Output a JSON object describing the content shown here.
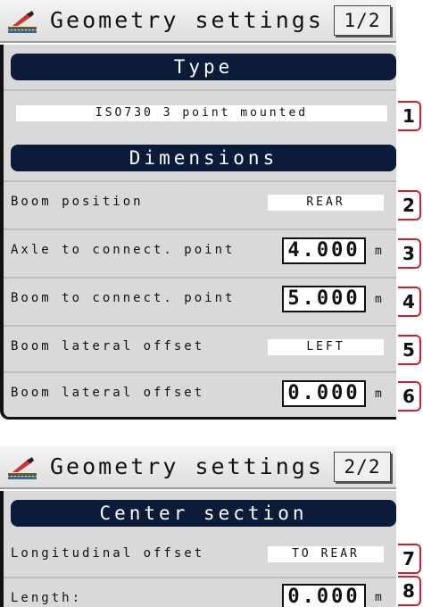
{
  "screen1": {
    "title": "Geometry settings",
    "page": "1/2",
    "type_header": "Type",
    "type_value": "ISO730 3 point mounted",
    "type_callout": "1",
    "dimensions_header": "Dimensions",
    "rows": [
      {
        "label": "Boom position",
        "value": "REAR",
        "unit": "",
        "callout": "2"
      },
      {
        "label": "Axle to connect. point",
        "value": "4.000",
        "unit": "m",
        "callout": "3"
      },
      {
        "label": "Boom to connect. point",
        "value": "5.000",
        "unit": "m",
        "callout": "4"
      },
      {
        "label": "Boom lateral offset",
        "value": "LEFT",
        "unit": "",
        "callout": "5"
      },
      {
        "label": "Boom lateral offset",
        "value": "0.000",
        "unit": "m",
        "callout": "6"
      }
    ]
  },
  "screen2": {
    "title": "Geometry settings",
    "page": "2/2",
    "center_header": "Center section",
    "rows": [
      {
        "label": "Longitudinal offset",
        "value": "TO REAR",
        "unit": "",
        "callout": "7"
      },
      {
        "label": "Length:",
        "value": "0.000",
        "unit": "m",
        "callout": "8"
      }
    ]
  },
  "icons": {
    "app": "sprayer-settings-icon"
  },
  "colors": {
    "header_bar": "#0c1b3a",
    "callout_border": "#d21f2a",
    "panel": "#d9d9d9"
  }
}
